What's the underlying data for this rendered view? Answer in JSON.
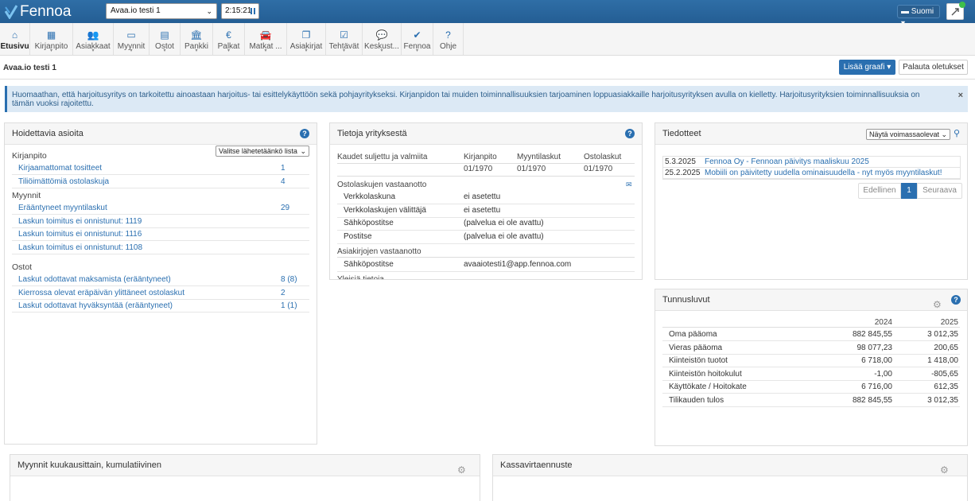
{
  "app": {
    "name": "Fennoa",
    "company": "Avaa.io testi 1",
    "timer": "2:15:21",
    "language": "Suomi"
  },
  "nav": [
    {
      "label": "Etusivu",
      "icon": "home-icon",
      "glyph": "⌂"
    },
    {
      "label": "Kirjanpito",
      "icon": "calculator-icon",
      "glyph": "▦"
    },
    {
      "label": "Asiakkaat",
      "icon": "users-icon",
      "glyph": "👥"
    },
    {
      "label": "Myynnit",
      "icon": "money-icon",
      "glyph": "▭"
    },
    {
      "label": "Ostot",
      "icon": "card-icon",
      "glyph": "▤"
    },
    {
      "label": "Pankki",
      "icon": "bank-icon",
      "glyph": "🏛"
    },
    {
      "label": "Palkat",
      "icon": "euro-icon",
      "glyph": "€"
    },
    {
      "label": "Matkat ...",
      "icon": "car-icon",
      "glyph": "🚘"
    },
    {
      "label": "Asiakirjat",
      "icon": "documents-icon",
      "glyph": "❐"
    },
    {
      "label": "Tehtävät",
      "icon": "checkbox-icon",
      "glyph": "☑"
    },
    {
      "label": "Keskust...",
      "icon": "chat-icon",
      "glyph": "💬"
    },
    {
      "label": "Fennoa",
      "icon": "fennoa-logo-icon",
      "glyph": "✔"
    },
    {
      "label": "Ohje",
      "icon": "help-icon",
      "glyph": "?"
    }
  ],
  "page": {
    "title": "Avaa.io testi 1",
    "add_graph": "Lisää graafi",
    "reset": "Palauta oletukset"
  },
  "alert": {
    "text": "Huomaathan, että harjoitusyritys on tarkoitettu ainoastaan harjoitus- tai esittelykäyttöön sekä pohjayritykseksi. Kirjanpidon tai muiden toiminnallisuuksien tarjoaminen loppuasiakkaille harjoitusyrityksen avulla on kielletty. Harjoitusyrityksien toiminnallisuuksia on tämän vuoksi rajoitettu.",
    "close": "×"
  },
  "todo": {
    "title": "Hoidettavia asioita",
    "select": "Valitse lähetetäänkö lista",
    "groups": [
      {
        "name": "Kirjanpito",
        "items": [
          {
            "label": "Kirjaamattomat tositteet",
            "value": "1"
          },
          {
            "label": "Tiliöimättömiä ostolaskuja",
            "value": "4"
          }
        ]
      },
      {
        "name": "Myynnit",
        "items": [
          {
            "label": "Erääntyneet myyntilaskut",
            "value": "29"
          },
          {
            "label": "Laskun toimitus ei onnistunut: 1119",
            "value": ""
          },
          {
            "label": "Laskun toimitus ei onnistunut: 1116",
            "value": ""
          },
          {
            "label": "Laskun toimitus ei onnistunut: 1108",
            "value": ""
          }
        ]
      },
      {
        "name": "Ostot",
        "items": [
          {
            "label": "Laskut odottavat maksamista (erääntyneet)",
            "value": "8 (8)"
          },
          {
            "label": "Kierrossa olevat eräpäivän ylittäneet ostolaskut",
            "value": "2"
          },
          {
            "label": "Laskut odottavat hyväksyntää (erääntyneet)",
            "value": "1 (1)"
          }
        ]
      }
    ]
  },
  "company": {
    "title": "Tietoja yrityksestä",
    "periods_header": [
      "Kaudet suljettu ja valmiita",
      "Kirjanpito",
      "Myyntilaskut",
      "Ostolaskut"
    ],
    "periods_values": [
      "",
      "01/1970",
      "01/1970",
      "01/1970"
    ],
    "purchase_title": "Ostolaskujen vastaanotto",
    "purchase_rows": [
      {
        "k": "Verkkolaskuna",
        "v": "ei asetettu"
      },
      {
        "k": "Verkkolaskujen välittäjä",
        "v": "ei asetettu"
      },
      {
        "k": "Sähköpostitse",
        "v": "(palvelua ei ole avattu)"
      },
      {
        "k": "Postitse",
        "v": "(palvelua ei ole avattu)"
      }
    ],
    "docs_title": "Asiakirjojen vastaanotto",
    "docs_rows": [
      {
        "k": "Sähköpostitse",
        "v": "avaaiotesti1@app.fennoa.com"
      }
    ],
    "general_title": "Yleisiä tietoja"
  },
  "news": {
    "title": "Tiedotteet",
    "filter": "Näytä voimassaolevat",
    "items": [
      {
        "date": "5.3.2025",
        "text": "Fennoa Oy - Fennoan päivitys maaliskuu 2025"
      },
      {
        "date": "25.2.2025",
        "text": "Mobiili on päivitetty uudella ominaisuudella - nyt myös myyntilaskut!"
      }
    ],
    "prev": "Edellinen",
    "page": "1",
    "next": "Seuraava"
  },
  "kpi": {
    "title": "Tunnusluvut",
    "years": [
      "2024",
      "2025"
    ],
    "rows": [
      {
        "label": "Oma pääoma",
        "a": "882 845,55",
        "b": "3 012,35"
      },
      {
        "label": "Vieras pääoma",
        "a": "98 077,23",
        "b": "200,65"
      },
      {
        "label": "Kiinteistön tuotot",
        "a": "6 718,00",
        "b": "1 418,00"
      },
      {
        "label": "Kiinteistön hoitokulut",
        "a": "-1,00",
        "b": "-805,65"
      },
      {
        "label": "Käyttökate / Hoitokate",
        "a": "6 716,00",
        "b": "612,35"
      },
      {
        "label": "Tilikauden tulos",
        "a": "882 845,55",
        "b": "3 012,35"
      }
    ]
  },
  "sales_chart": {
    "title": "Myynnit kuukausittain, kumulatiivinen"
  },
  "cash_chart": {
    "title": "Kassavirtaennuste"
  }
}
